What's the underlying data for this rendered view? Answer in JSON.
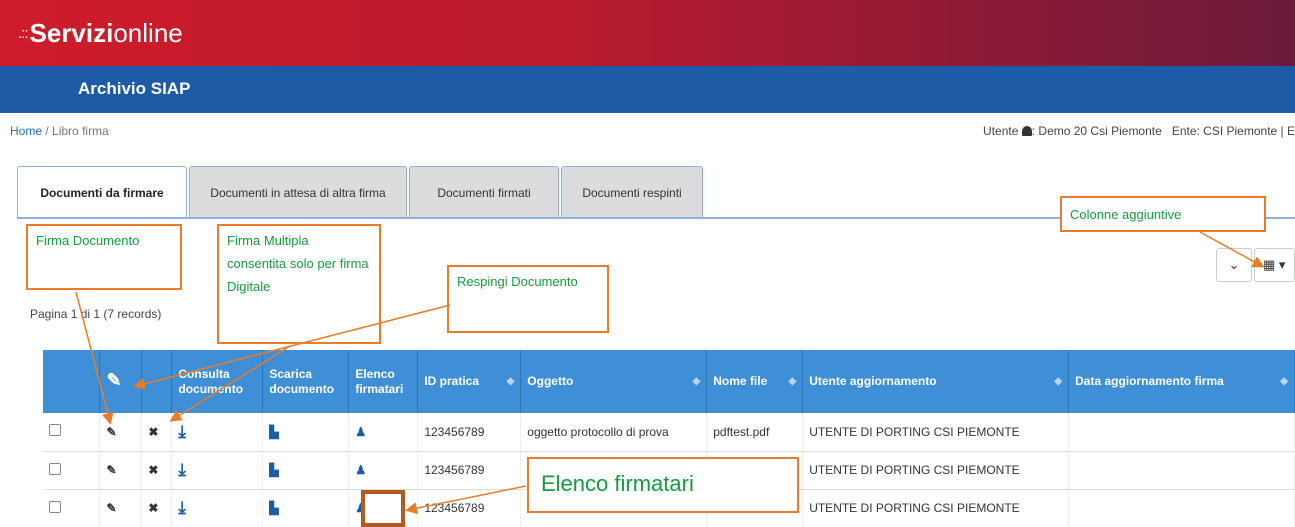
{
  "brand": {
    "dots": ".::",
    "bold": "Servizi",
    "light": "online"
  },
  "app": {
    "title": "Archivio SIAP"
  },
  "breadcrumb": {
    "home": "Home",
    "separator": "/",
    "current": "Libro firma"
  },
  "user": {
    "label": "Utente",
    "name": ": Demo 20 Csi Piemonte",
    "ente": "Ente: CSI Piemonte | E"
  },
  "tabs": [
    {
      "label": "Documenti da firmare",
      "active": true
    },
    {
      "label": "Documenti in attesa di altra firma",
      "active": false
    },
    {
      "label": "Documenti firmati",
      "active": false
    },
    {
      "label": "Documenti respinti",
      "active": false
    }
  ],
  "toolbar": {
    "collapse_glyph": "⌄",
    "columns_glyph": "▦ ▾"
  },
  "pager": {
    "text": "Pagina 1 di 1 (7 records)"
  },
  "callouts": {
    "firma_documento": "Firma Documento",
    "firma_multipla": "Firma Multipla consentita solo per firma Digitale",
    "respingi": "Respingi Documento",
    "colonne": "Colonne aggiuntive",
    "elenco": "Elenco firmatari"
  },
  "table": {
    "columns": {
      "sign_icon": "✎",
      "consulta": "Consulta documento",
      "scarica": "Scarica documento",
      "elenco": "Elenco firmatari",
      "id": "ID pratica",
      "oggetto": "Oggetto",
      "nome": "Nome file",
      "utente": "Utente aggiornamento",
      "data": "Data aggiornamento firma"
    },
    "icons": {
      "edit": "✎",
      "reject": "✖",
      "download": "⤓",
      "file": "▙",
      "user": "♟"
    },
    "rows": [
      {
        "id": "123456789",
        "oggetto": "oggetto protocollo di prova",
        "nome": "pdftest.pdf",
        "utente": "UTENTE DI PORTING CSI PIEMONTE",
        "data": ""
      },
      {
        "id": "123456789",
        "oggetto": "",
        "nome": "",
        "utente": "UTENTE DI PORTING CSI PIEMONTE",
        "data": ""
      },
      {
        "id": "123456789",
        "oggetto": "",
        "nome": "",
        "utente": "UTENTE DI PORTING CSI PIEMONTE",
        "data": ""
      }
    ]
  },
  "colors": {
    "brand_red": "#cf1c2a",
    "app_blue": "#1d5ba6",
    "header_blue": "#3e8fd6",
    "callout_border": "#e87c2a",
    "callout_text": "#179b3f"
  }
}
